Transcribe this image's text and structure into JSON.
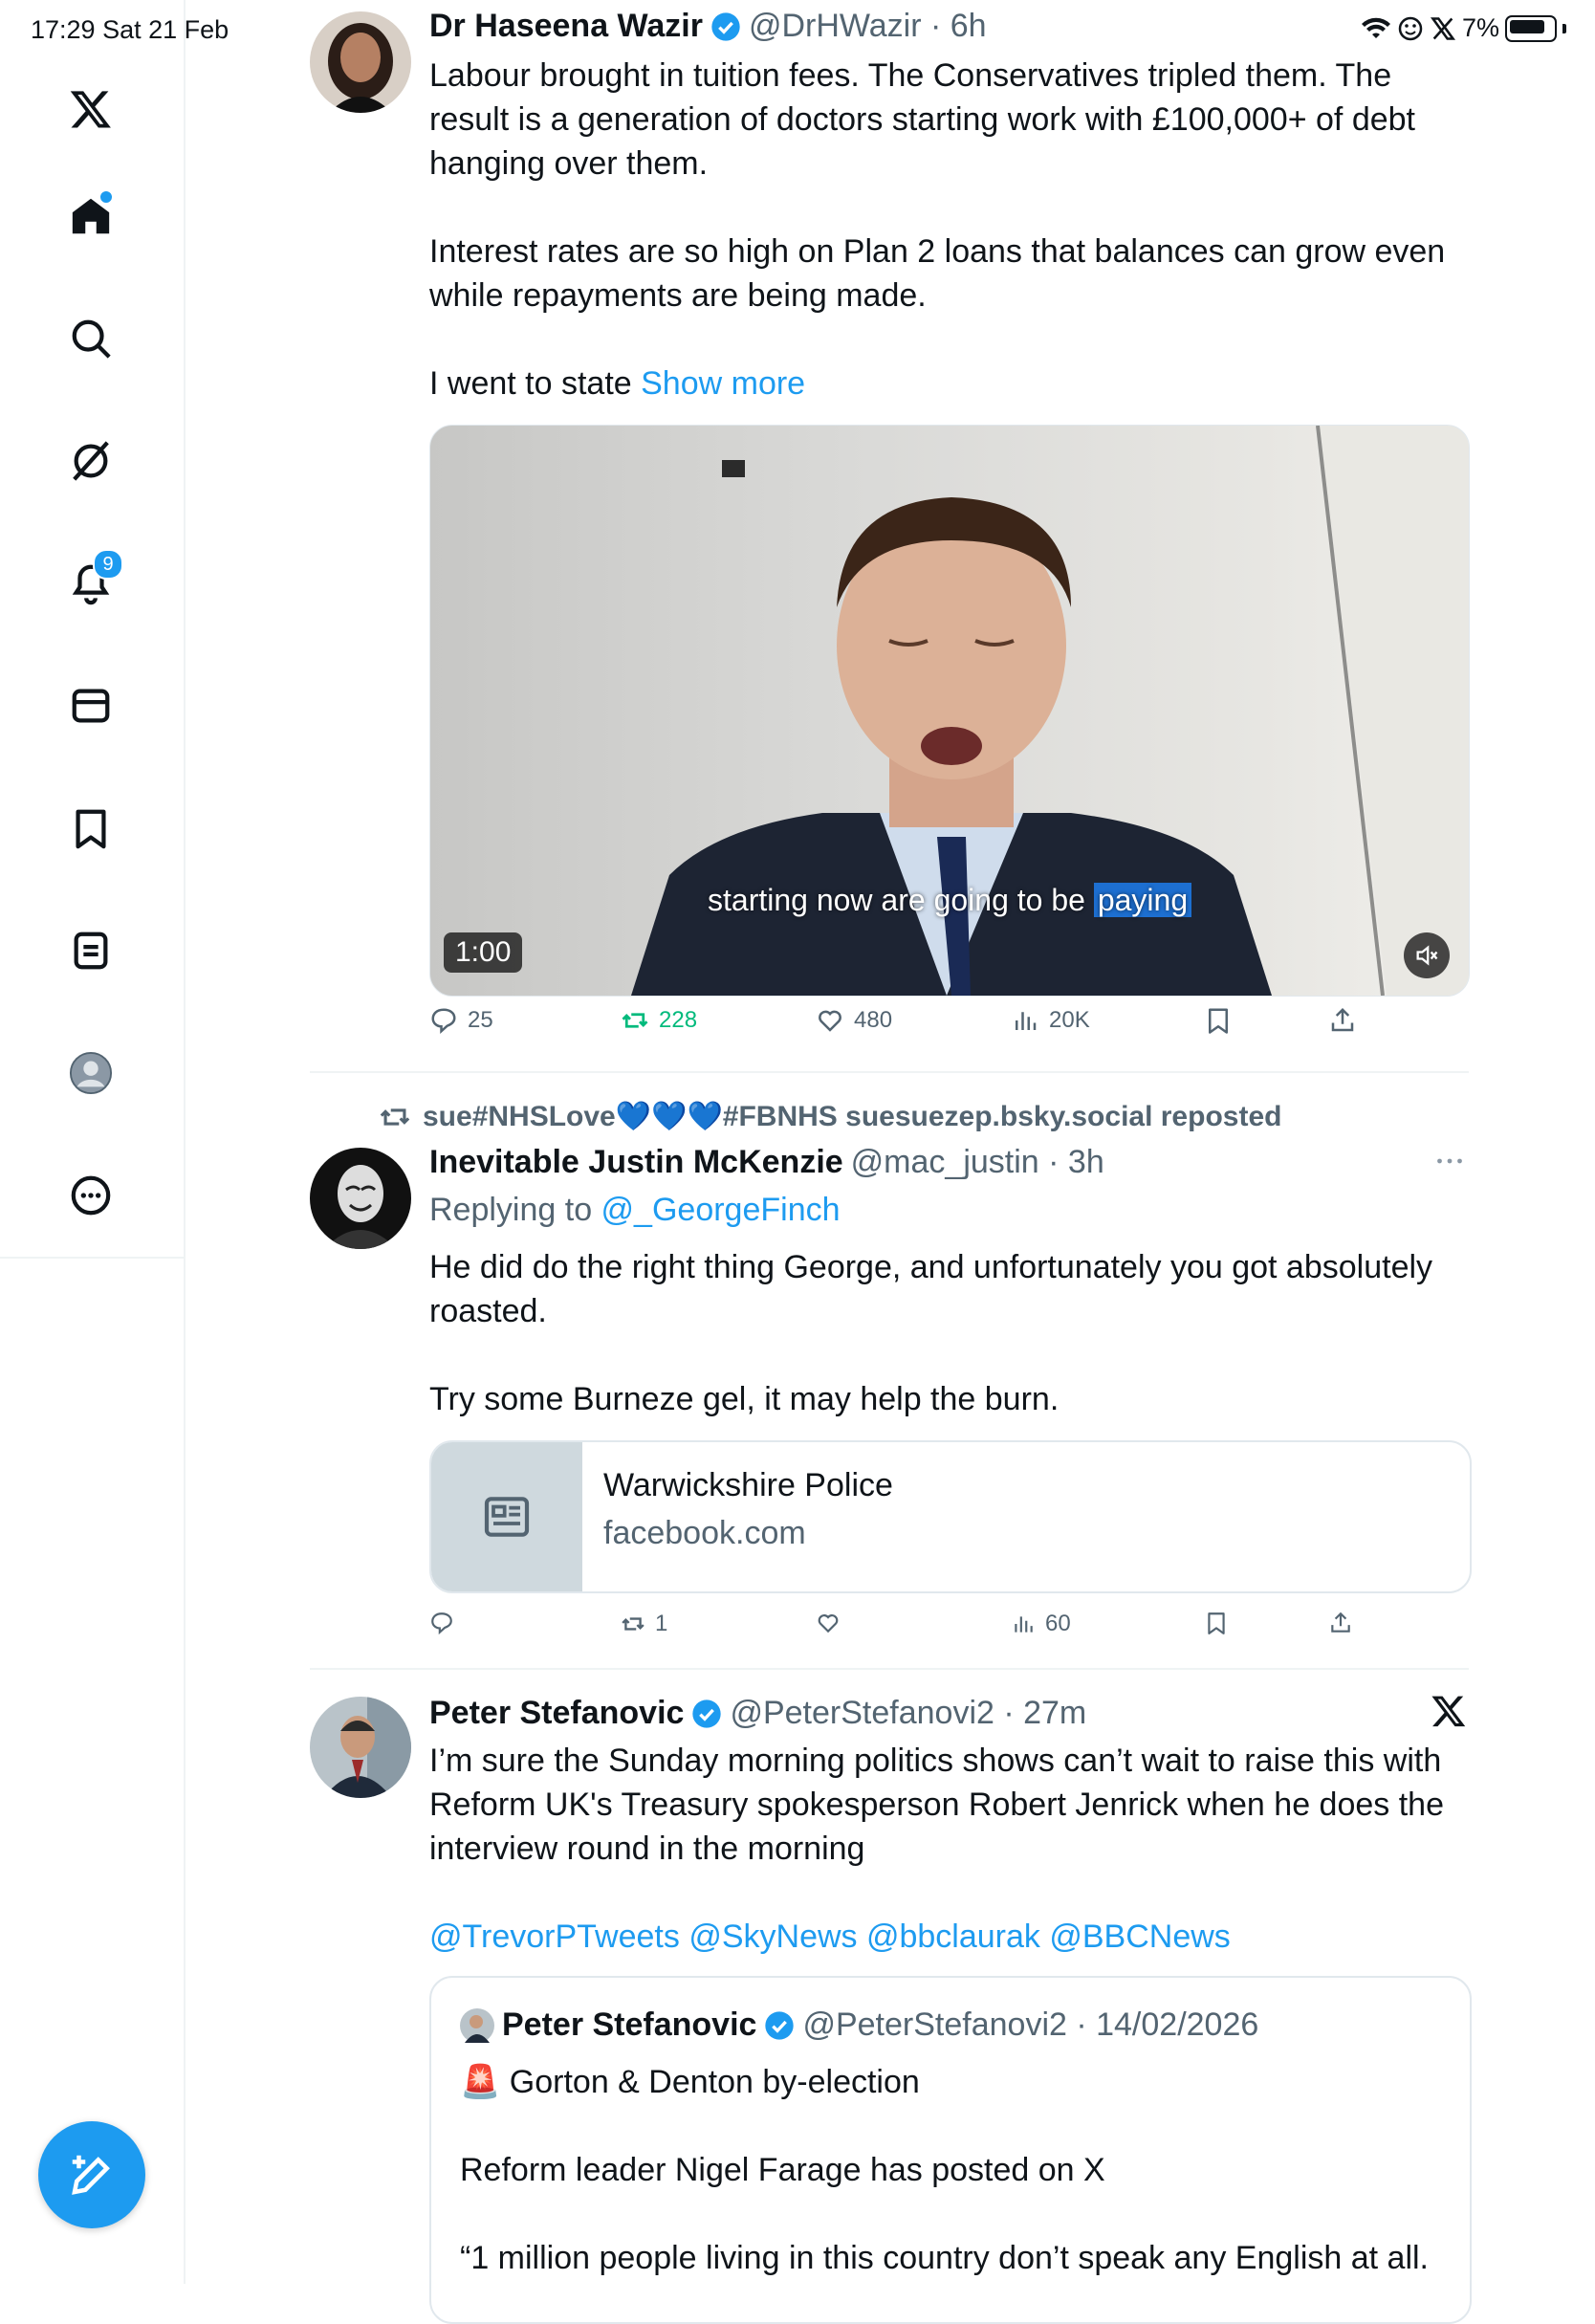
{
  "status_bar": {
    "time_date": "17:29  Sat 21 Feb",
    "battery": "7%"
  },
  "sidebar": {
    "notifications_badge": "9"
  },
  "tweet1": {
    "name": "Dr Haseena Wazir",
    "handle_time": "@DrHWazir · 6h",
    "para1": "Labour brought in tuition fees. The Conservatives tripled them. The result is a generation of doctors starting work with £100,000+ of debt hanging over them.",
    "para2": "Interest rates are so high on Plan 2 loans that balances can grow even while repayments are being made.",
    "para3_text": "I went to state ",
    "show_more": "Show more",
    "video": {
      "caption_before": "starting now are going to be ",
      "caption_highlight": "paying",
      "duration": "1:00"
    },
    "replies": "25",
    "reposts": "228",
    "likes": "480",
    "views": "20K"
  },
  "tweet2": {
    "repost_banner": "sue#NHSLove💙💙💙#FBNHS suesuezep.bsky.social reposted",
    "name": "Inevitable Justin McKenzie",
    "handle_time": "@mac_justin · 3h",
    "replying_prefix": "Replying to ",
    "replying_handle": "@_GeorgeFinch",
    "para1": "He did do the right thing George, and unfortunately you got absolutely roasted.",
    "para2": "Try some Burneze gel, it may help the burn.",
    "card_title": "Warwickshire Police",
    "card_domain": "facebook.com",
    "replies": "",
    "reposts": "1",
    "likes": "",
    "views": "60"
  },
  "tweet3": {
    "name": "Peter Stefanovic",
    "handle_time": "@PeterStefanovi2 · 27m",
    "para1": "I’m sure the Sunday morning politics shows can’t wait to raise this with Reform UK's Treasury spokesperson Robert Jenrick when he does the interview round in the morning",
    "mentions": "@TrevorPTweets @SkyNews @bbclaurak @BBCNews",
    "quote": {
      "name": "Peter Stefanovic",
      "handle_time": "@PeterStefanovi2 · 14/02/2026",
      "line1": "🚨 Gorton & Denton by-election",
      "line2": "Reform leader Nigel Farage has posted on X",
      "line3": "“1 million people living in this country don’t speak any English at all."
    }
  },
  "colors": {
    "accent": "#1d9bf0",
    "repost_green": "#00ba7c",
    "secondary_text": "#536471"
  }
}
